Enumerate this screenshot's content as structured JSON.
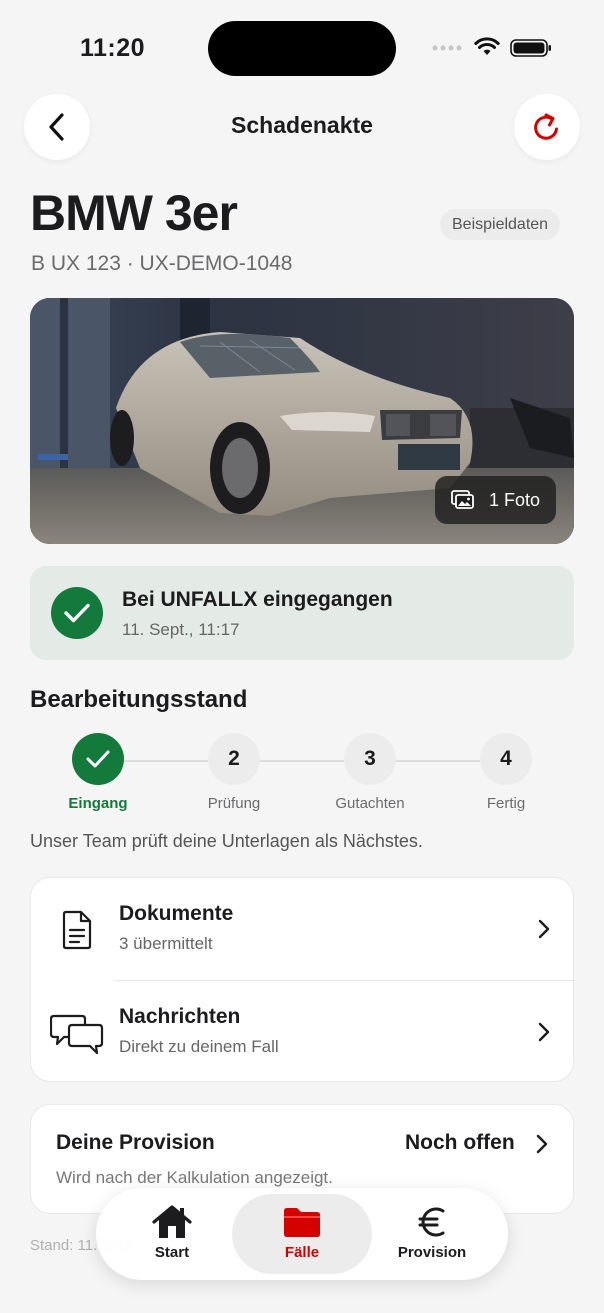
{
  "status_bar": {
    "time": "11:20"
  },
  "header": {
    "title": "Schadenakte"
  },
  "vehicle": {
    "title": "BMW 3er",
    "badge": "Beispieldaten",
    "subtitle": "B UX 123 · UX-DEMO-1048",
    "photo_count_label": "1 Foto"
  },
  "received": {
    "title": "Bei UNFALLX eingegangen",
    "time": "11. Sept., 11:17"
  },
  "progress": {
    "title": "Bearbeitungsstand",
    "steps": [
      {
        "number": "",
        "label": "Eingang",
        "done": true
      },
      {
        "number": "2",
        "label": "Prüfung",
        "done": false
      },
      {
        "number": "3",
        "label": "Gutachten",
        "done": false
      },
      {
        "number": "4",
        "label": "Fertig",
        "done": false
      }
    ],
    "note": "Unser Team prüft deine Unterlagen als Nächstes."
  },
  "links": [
    {
      "title": "Dokumente",
      "subtitle": "3 übermittelt",
      "icon": "document-icon"
    },
    {
      "title": "Nachrichten",
      "subtitle": "Direkt zu deinem Fall",
      "icon": "chat-bubbles-icon"
    }
  ],
  "provision": {
    "title": "Deine Provision",
    "value": "Noch offen",
    "subtitle": "Wird nach der Kalkulation angezeigt."
  },
  "footer": {
    "stand": "Stand: 11. Sept."
  },
  "tabbar": {
    "tabs": [
      {
        "label": "Start",
        "icon": "home-icon"
      },
      {
        "label": "Fälle",
        "icon": "folder-icon",
        "active": true
      },
      {
        "label": "Provision",
        "icon": "euro-icon"
      }
    ]
  },
  "colors": {
    "accent_green": "#137a3c",
    "accent_red": "#d50000",
    "background": "#f5f5f5"
  }
}
